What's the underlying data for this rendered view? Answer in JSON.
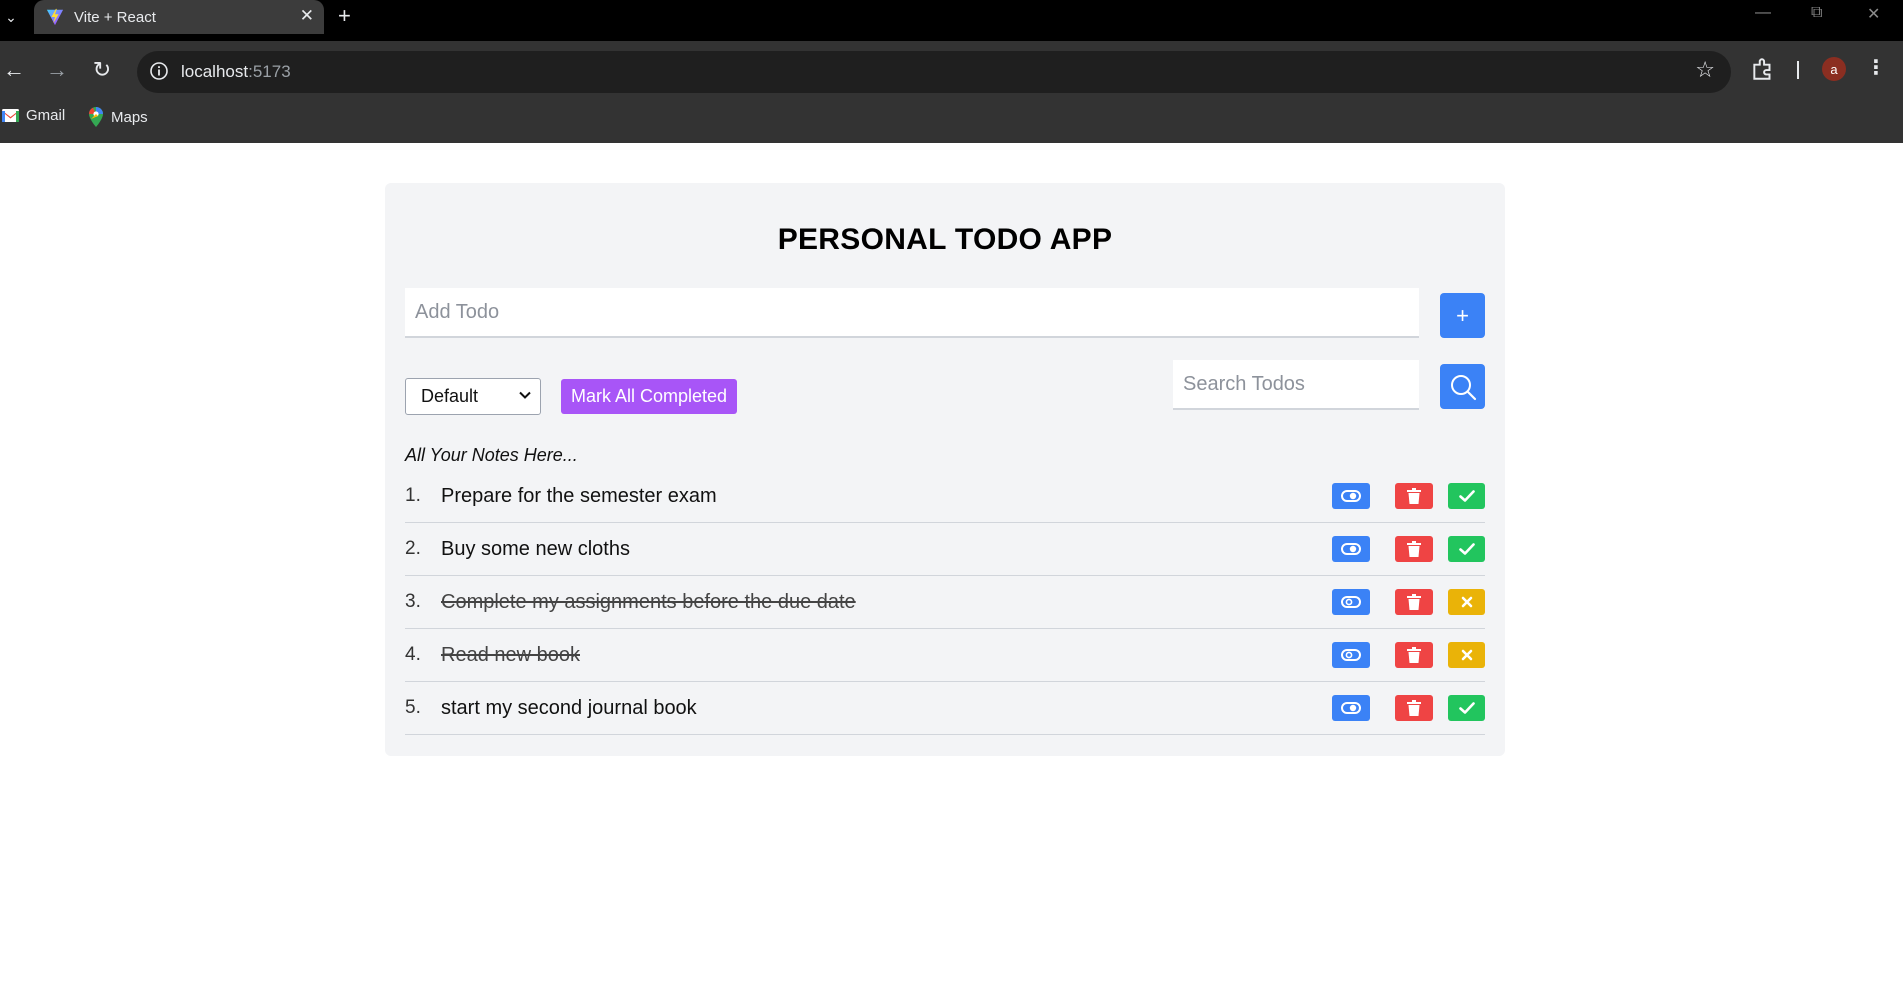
{
  "browser": {
    "tab_title": "Vite + React",
    "url_host": "localhost",
    "url_port": ":5173",
    "bookmarks": [
      {
        "label": "Gmail",
        "icon": "gmail-icon"
      },
      {
        "label": "Maps",
        "icon": "maps-icon"
      }
    ],
    "profile_initial": "a"
  },
  "app": {
    "title": "PERSONAL TODO APP",
    "add_placeholder": "Add Todo",
    "add_button_label": "+",
    "filter_selected": "Default",
    "mark_all_label": "Mark All Completed",
    "search_placeholder": "Search Todos",
    "notes_heading": "All Your Notes Here...",
    "todos": [
      {
        "number": "1.",
        "text": "Prepare for the semester exam",
        "completed": false
      },
      {
        "number": "2.",
        "text": "Buy some new cloths",
        "completed": false
      },
      {
        "number": "3.",
        "text": "Complete my assignments before the due date",
        "completed": true
      },
      {
        "number": "4.",
        "text": "Read new book",
        "completed": true
      },
      {
        "number": "5.",
        "text": "start my second journal book",
        "completed": false
      }
    ]
  },
  "colors": {
    "primary_blue": "#3b82f6",
    "delete_red": "#ef4444",
    "complete_green": "#22c55e",
    "undo_yellow": "#eab308",
    "mark_all_purple": "#a855f7",
    "card_bg": "#f3f4f6"
  }
}
